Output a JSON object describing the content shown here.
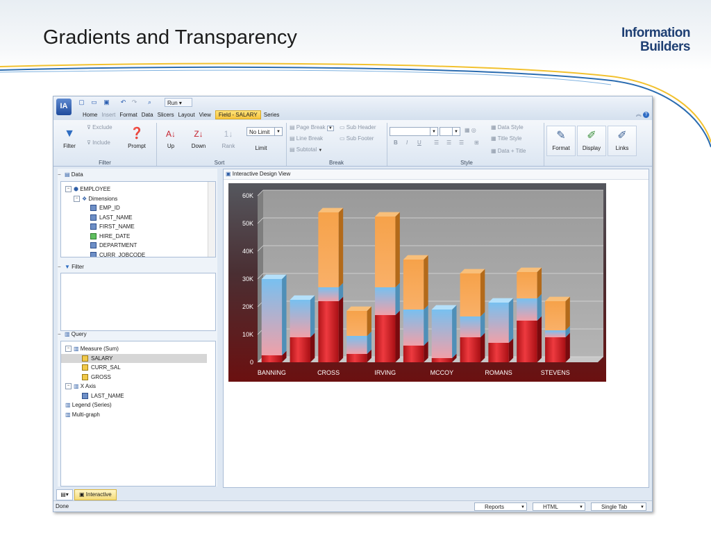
{
  "slide": {
    "title": "Gradients and Transparency",
    "logo_line1": "Information",
    "logo_line2": "Builders"
  },
  "app": {
    "icon": "IA",
    "run_label": "Run ▾",
    "menu": [
      "Home",
      "Insert",
      "Format",
      "Data",
      "Slicers",
      "Layout",
      "View",
      "Field - SALARY",
      "Series"
    ]
  },
  "ribbon": {
    "filter": {
      "filter": "Filter",
      "exclude": "Exclude",
      "include": "Include",
      "prompt": "Prompt",
      "group": "Filter"
    },
    "sort": {
      "up": "Up",
      "down": "Down",
      "rank": "Rank",
      "limit_value": "No Limit",
      "limit": "Limit",
      "group": "Sort"
    },
    "break": {
      "page_break": "Page Break",
      "line_break": "Line Break",
      "subtotal": "Subtotal",
      "sub_header": "Sub Header",
      "sub_footer": "Sub Footer",
      "group": "Break"
    },
    "style": {
      "data_style": "Data Style",
      "title_style": "Title Style",
      "data_title": "Data + Title",
      "group": "Style",
      "format": "Format",
      "display": "Display",
      "links": "Links"
    }
  },
  "left": {
    "data_title": "Data",
    "data_tree": [
      {
        "label": "EMPLOYEE",
        "level": 0,
        "kind": "db",
        "pm": "−"
      },
      {
        "label": "Dimensions",
        "level": 1,
        "kind": "dim",
        "pm": "−"
      },
      {
        "label": "EMP_ID",
        "level": 2,
        "kind": "field"
      },
      {
        "label": "LAST_NAME",
        "level": 2,
        "kind": "field"
      },
      {
        "label": "FIRST_NAME",
        "level": 2,
        "kind": "field"
      },
      {
        "label": "HIRE_DATE",
        "level": 2,
        "kind": "date"
      },
      {
        "label": "DEPARTMENT",
        "level": 2,
        "kind": "field"
      },
      {
        "label": "CURR_JOBCODE",
        "level": 2,
        "kind": "field"
      }
    ],
    "filter_title": "Filter",
    "query_title": "Query",
    "query_tree": [
      {
        "label": "Measure (Sum)",
        "level": 0,
        "kind": "bars",
        "pm": "−"
      },
      {
        "label": "SALARY",
        "level": 1,
        "kind": "measure",
        "selected": true
      },
      {
        "label": "CURR_SAL",
        "level": 1,
        "kind": "measure"
      },
      {
        "label": "GROSS",
        "level": 1,
        "kind": "measure"
      },
      {
        "label": "X Axis",
        "level": 0,
        "kind": "bars",
        "pm": "−"
      },
      {
        "label": "LAST_NAME",
        "level": 1,
        "kind": "field"
      },
      {
        "label": "Legend (Series)",
        "level": 0,
        "kind": "bars"
      },
      {
        "label": "Multi-graph",
        "level": 0,
        "kind": "bars"
      }
    ]
  },
  "content": {
    "title": "Interactive Design View"
  },
  "chart_data": {
    "type": "bar",
    "stacked": true,
    "categories": [
      "BANNING",
      "",
      "CROSS",
      "",
      "IRVING",
      "",
      "MCCOY",
      "",
      "ROMANS",
      "",
      "STEVENS",
      ""
    ],
    "visible_labels": [
      "BANNING",
      "CROSS",
      "IRVING",
      "MCCOY",
      "ROMANS",
      "STEVENS"
    ],
    "series": [
      {
        "name": "SALARY",
        "color": "#d8232a",
        "values": [
          2500,
          9000,
          22000,
          3000,
          17000,
          6000,
          1500,
          9000,
          7000,
          15000,
          9000,
          0
        ]
      },
      {
        "name": "CURR_SAL",
        "color": "#7cc4ef",
        "values": [
          27500,
          13500,
          5000,
          6500,
          10000,
          13000,
          17500,
          7500,
          14500,
          8000,
          2500,
          0
        ]
      },
      {
        "name": "GROSS",
        "color": "#f7a94b",
        "values": [
          0,
          0,
          27000,
          9000,
          25500,
          18000,
          0,
          15500,
          0,
          9500,
          10500,
          0
        ]
      }
    ],
    "yticks": [
      "0",
      "10K",
      "20K",
      "30K",
      "40K",
      "50K",
      "60K"
    ],
    "ylim": [
      0,
      60000
    ],
    "grid": true
  },
  "bottom": {
    "tab_label": "Interactive"
  },
  "status": {
    "left": "Done",
    "reports": "Reports",
    "html": "HTML",
    "single_tab": "Single Tab"
  }
}
